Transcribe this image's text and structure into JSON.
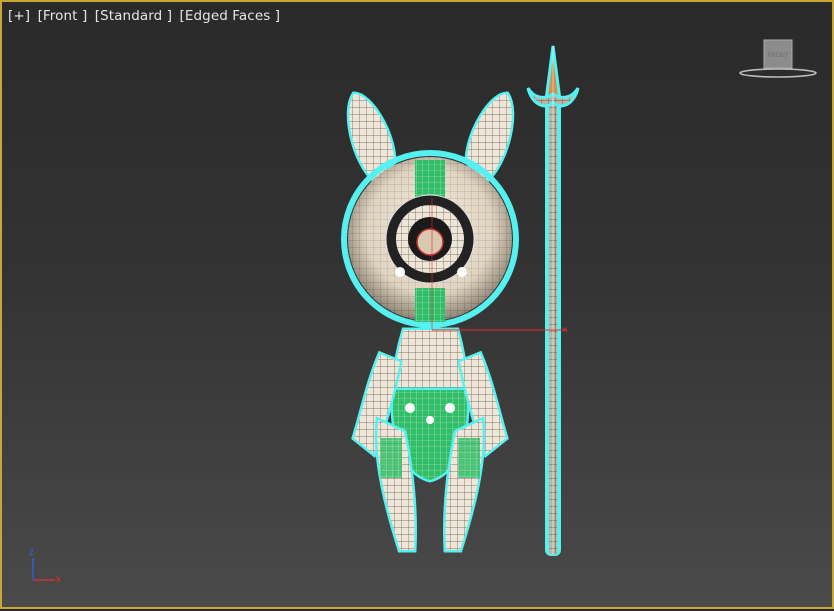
{
  "viewport": {
    "labels": {
      "plus": "[+]",
      "view": "[Front ]",
      "shading": "[Standard ]",
      "mode": "[Edged Faces ]"
    },
    "viewcube_face": "FRONT",
    "axis": {
      "x": "x",
      "z": "z"
    }
  },
  "colors": {
    "border": "#c8a832",
    "selection_wire": "#55f0f0",
    "body_fill": "#efe6d8",
    "accent_green": "#2fbf66",
    "axis_x": "#e03030",
    "axis_z": "#3060e0"
  },
  "icons": [
    "viewcube-icon",
    "axis-tripod-icon",
    "spear-object",
    "character-object"
  ]
}
